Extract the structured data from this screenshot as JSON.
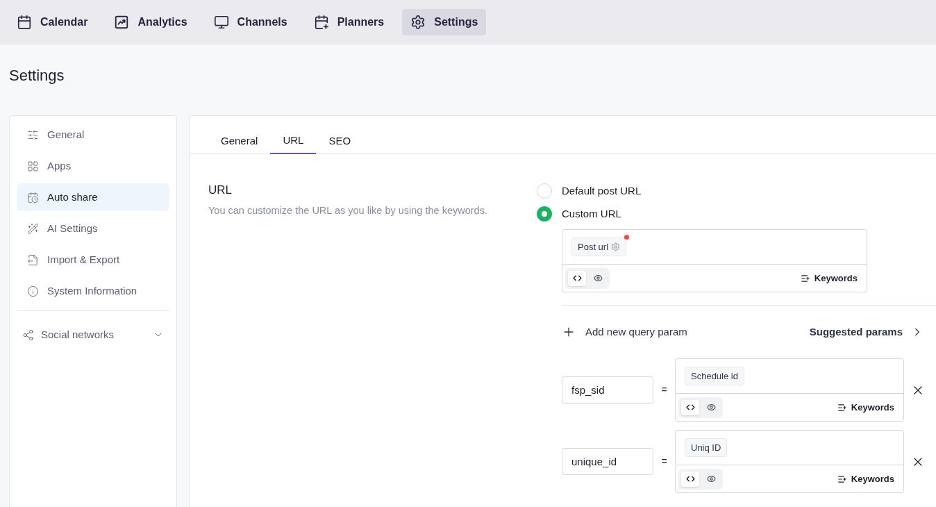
{
  "nav": [
    {
      "kind": "calendar",
      "label": "Calendar",
      "selected": false
    },
    {
      "kind": "analytics",
      "label": "Analytics",
      "selected": false
    },
    {
      "kind": "channels",
      "label": "Channels",
      "selected": false
    },
    {
      "kind": "planners",
      "label": "Planners",
      "selected": false
    },
    {
      "kind": "settings",
      "label": "Settings",
      "selected": true
    }
  ],
  "page_title": "Settings",
  "sidebar": {
    "items": [
      {
        "kind": "general",
        "label": "General",
        "selected": false
      },
      {
        "kind": "apps",
        "label": "Apps",
        "selected": false
      },
      {
        "kind": "autoshare",
        "label": "Auto share",
        "selected": true
      },
      {
        "kind": "ai",
        "label": "AI Settings",
        "selected": false
      },
      {
        "kind": "import",
        "label": "Import & Export",
        "selected": false
      },
      {
        "kind": "info",
        "label": "System Information",
        "selected": false
      }
    ],
    "group": {
      "label": "Social networks",
      "expanded": false
    }
  },
  "tabs": [
    {
      "label": "General",
      "selected": false
    },
    {
      "label": "URL",
      "selected": true
    },
    {
      "label": "SEO",
      "selected": false
    }
  ],
  "section": {
    "title": "URL",
    "description": "You can customize the URL as you like by using the keywords."
  },
  "url_options": [
    {
      "label": "Default post URL",
      "selected": false
    },
    {
      "label": "Custom URL",
      "selected": true
    }
  ],
  "url_editor": {
    "tag": "Post url",
    "tag_alert": true,
    "modes": [
      {
        "kind": "code",
        "selected": true
      },
      {
        "kind": "preview",
        "selected": false
      }
    ],
    "keywords": "Keywords"
  },
  "add_param": "Add new query param",
  "suggested": "Suggested params",
  "params": [
    {
      "name": "fsp_sid",
      "tag": "Schedule id",
      "modes": [
        {
          "kind": "code",
          "selected": true
        },
        {
          "kind": "preview",
          "selected": false
        }
      ],
      "keywords": "Keywords"
    },
    {
      "name": "unique_id",
      "tag": "Uniq ID",
      "modes": [
        {
          "kind": "code",
          "selected": true
        },
        {
          "kind": "preview",
          "selected": false
        }
      ],
      "keywords": "Keywords"
    }
  ],
  "equals": "="
}
